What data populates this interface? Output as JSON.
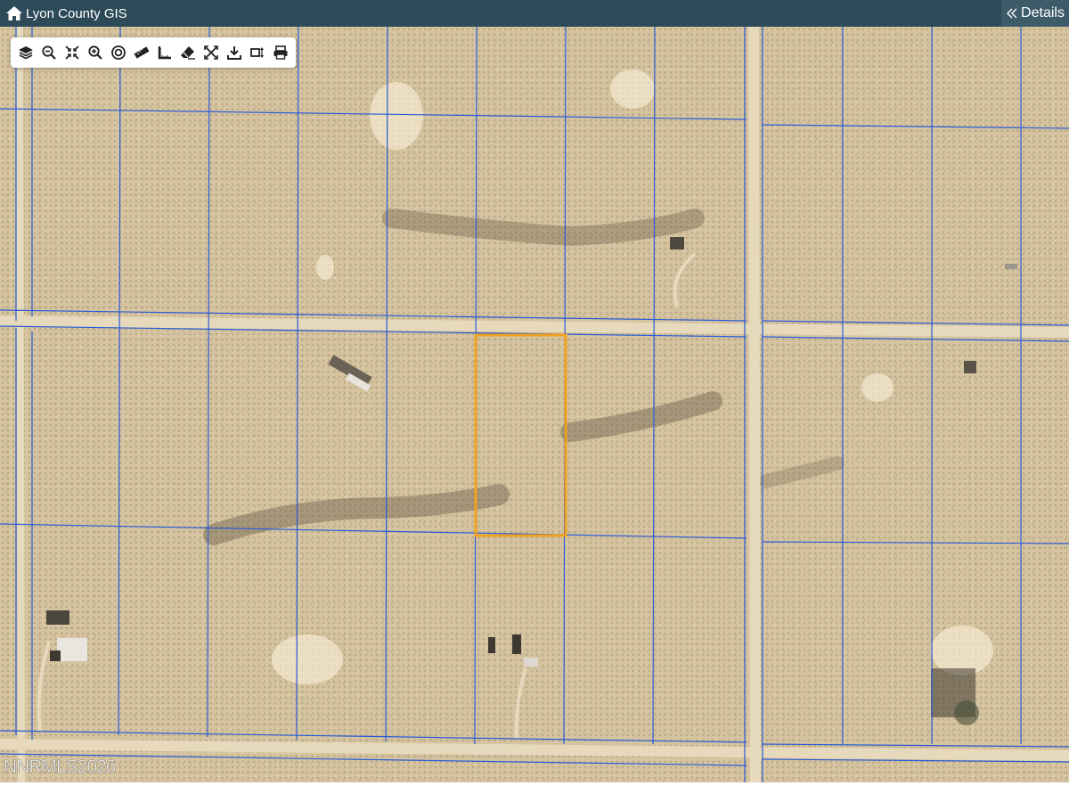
{
  "header": {
    "title": "Lyon County GIS",
    "home_icon": "home-icon",
    "details_label": "Details",
    "details_icon": "double-chevron-left-icon"
  },
  "toolbar": {
    "tools": [
      {
        "name": "layers",
        "icon": "layers-icon"
      },
      {
        "name": "zoom-out",
        "icon": "zoom-out-icon"
      },
      {
        "name": "zoom-extent",
        "icon": "zoom-extent-icon"
      },
      {
        "name": "zoom-in",
        "icon": "zoom-in-icon"
      },
      {
        "name": "locate",
        "icon": "target-icon"
      },
      {
        "name": "measure",
        "icon": "ruler-icon"
      },
      {
        "name": "measure-area",
        "icon": "area-ruler-icon"
      },
      {
        "name": "erase",
        "icon": "eraser-icon"
      },
      {
        "name": "full-screen",
        "icon": "fullscreen-icon"
      },
      {
        "name": "download",
        "icon": "download-icon"
      },
      {
        "name": "frame-select",
        "icon": "frame-select-icon"
      },
      {
        "name": "print",
        "icon": "print-icon"
      }
    ]
  },
  "map": {
    "basemap": "aerial imagery",
    "parcel_line_color": "#2a5bd7",
    "highlight_color": "#f0a21e",
    "road_color": "#e3d6b8",
    "watermark": "NNRMLS2026"
  }
}
